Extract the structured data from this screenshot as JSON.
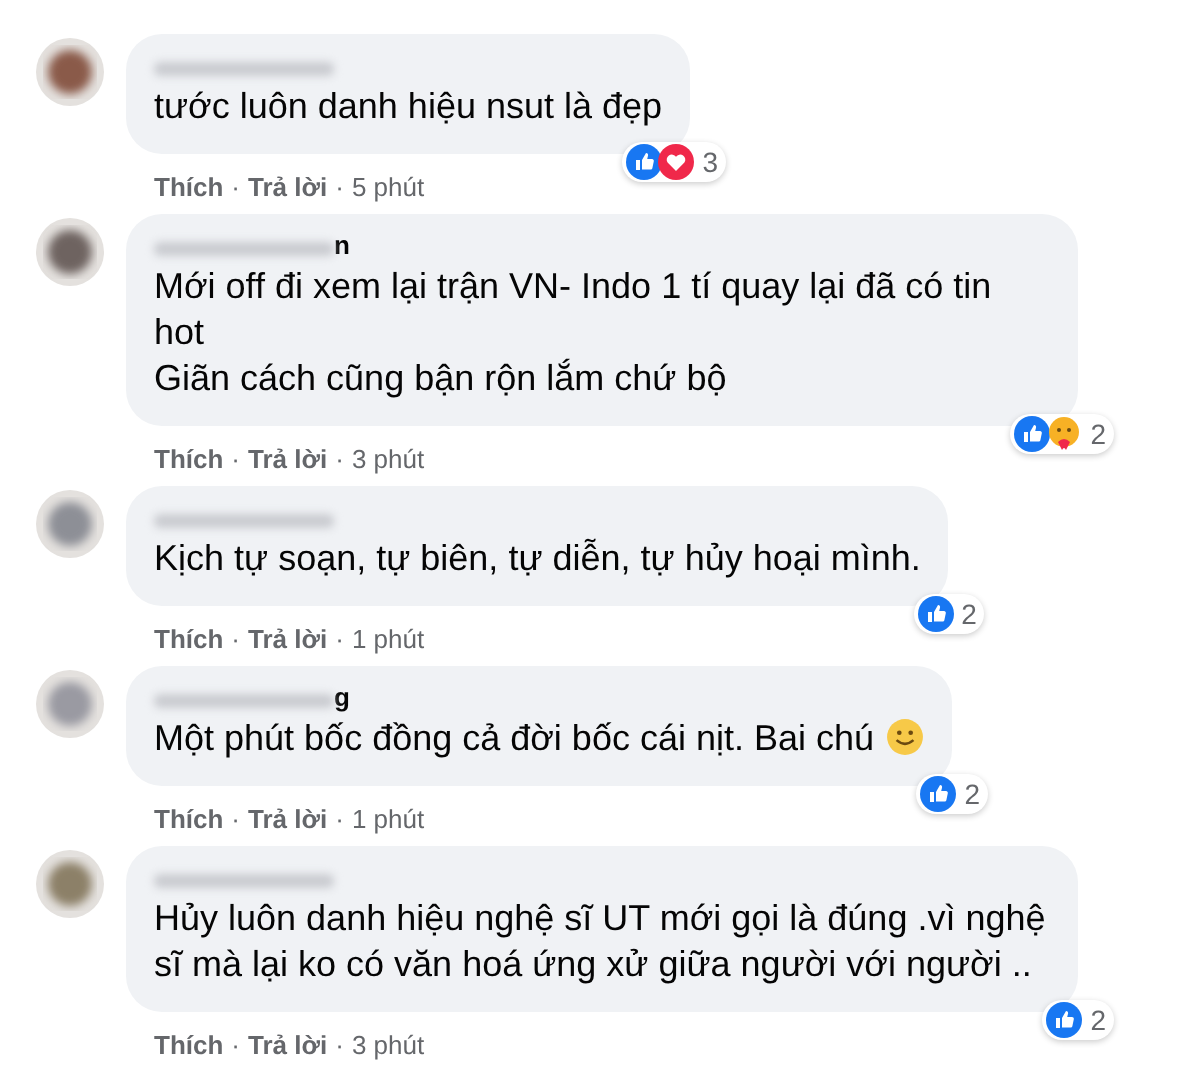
{
  "comments": [
    {
      "text": "tước luôn danh hiệu nsut là đẹp",
      "reactions": [
        {
          "kind": "like"
        },
        {
          "kind": "love"
        }
      ],
      "reaction_count": "3",
      "like": "Thích",
      "sep1": "·",
      "reply": "Trả lời",
      "sep2": "·",
      "time": "5 phút"
    },
    {
      "name_visible": "n",
      "text": "Mới off đi xem lại trận VN- Indo 1 tí quay lại đã có tin hot\nGiãn cách cũng bận rộn lắm chứ bộ",
      "reactions": [
        {
          "kind": "like"
        },
        {
          "kind": "care"
        }
      ],
      "reaction_count": "2",
      "like": "Thích",
      "sep1": "·",
      "reply": "Trả lời",
      "sep2": "·",
      "time": "3 phút"
    },
    {
      "text": "Kịch tự soạn, tự biên, tự diễn, tự hủy hoại mình.",
      "reactions": [
        {
          "kind": "like"
        }
      ],
      "reaction_count": "2",
      "like": "Thích",
      "sep1": "·",
      "reply": "Trả lời",
      "sep2": "·",
      "time": "1 phút"
    },
    {
      "name_visible": "g",
      "text": "Một phút bốc đồng cả đời bốc cái nịt. Bai chú",
      "trailing_emoji": true,
      "reactions": [
        {
          "kind": "like"
        }
      ],
      "reaction_count": "2",
      "like": "Thích",
      "sep1": "·",
      "reply": "Trả lời",
      "sep2": "·",
      "time": "1 phút"
    },
    {
      "text": "Hủy luôn danh hiệu nghệ sĩ UT mới gọi là đúng .vì nghệ sĩ mà lại ko có văn hoá ứng xử giữa người với người ..",
      "reactions": [
        {
          "kind": "like"
        }
      ],
      "reaction_count": "2",
      "like": "Thích",
      "sep1": "·",
      "reply": "Trả lời",
      "sep2": "·",
      "time": "3 phút"
    }
  ]
}
